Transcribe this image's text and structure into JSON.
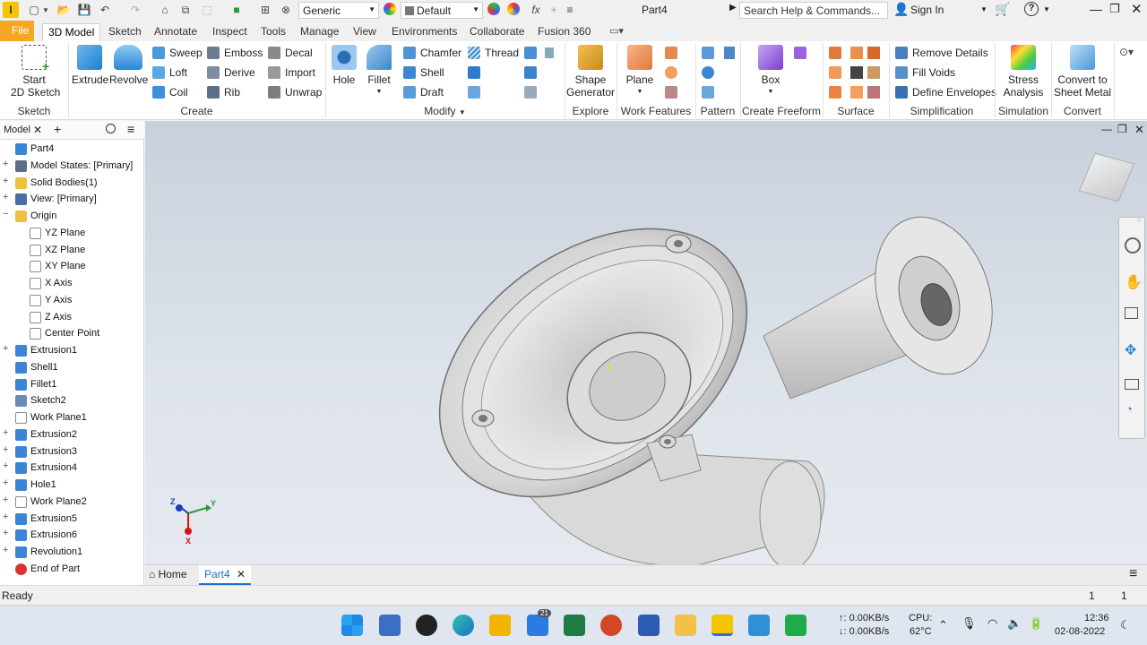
{
  "titlebar": {
    "workspace": "Generic",
    "appearance": "Default",
    "doc_title": "Part4",
    "search_placeholder": "Search Help & Commands...",
    "sign_in": "Sign In",
    "fx": "fx"
  },
  "menu_tabs": [
    "File",
    "3D Model",
    "Sketch",
    "Annotate",
    "Inspect",
    "Tools",
    "Manage",
    "View",
    "Environments",
    "Collaborate",
    "Fusion 360"
  ],
  "ribbon": {
    "sketch": {
      "start_sketch": "Start\n2D Sketch",
      "group": "Sketch"
    },
    "create": {
      "extrude": "Extrude",
      "revolve": "Revolve",
      "sweep": "Sweep",
      "loft": "Loft",
      "coil": "Coil",
      "emboss": "Emboss",
      "derive": "Derive",
      "rib": "Rib",
      "decal": "Decal",
      "import": "Import",
      "unwrap": "Unwrap",
      "group": "Create"
    },
    "modify": {
      "hole": "Hole",
      "fillet": "Fillet",
      "chamfer": "Chamfer",
      "thread": "Thread",
      "shell": "Shell",
      "draft": "Draft",
      "group": "Modify"
    },
    "explore": {
      "shape_generator": "Shape\nGenerator",
      "group": "Explore"
    },
    "work_features": {
      "plane": "Plane",
      "group": "Work Features"
    },
    "pattern": {
      "group": "Pattern"
    },
    "freeform": {
      "box": "Box",
      "group": "Create Freeform"
    },
    "surface": {
      "group": "Surface"
    },
    "simplification": {
      "remove_details": "Remove Details",
      "fill_voids": "Fill Voids",
      "define_envelopes": "Define Envelopes",
      "group": "Simplification"
    },
    "simulation": {
      "stress_analysis": "Stress\nAnalysis",
      "group": "Simulation"
    },
    "convert": {
      "convert_sheet_metal": "Convert to\nSheet Metal",
      "group": "Convert"
    }
  },
  "model_panel": {
    "title": "Model",
    "tree": [
      {
        "label": "Part4",
        "icon": "part-icon",
        "expander": ""
      },
      {
        "label": "Model States: [Primary]",
        "icon": "model-states-icon",
        "expander": "+"
      },
      {
        "label": "Solid Bodies(1)",
        "icon": "folder-icon",
        "expander": "+"
      },
      {
        "label": "View: [Primary]",
        "icon": "view-icon",
        "expander": "+"
      },
      {
        "label": "Origin",
        "icon": "folder-icon",
        "expander": "−"
      },
      {
        "label": "YZ Plane",
        "icon": "plane-icon",
        "expander": ""
      },
      {
        "label": "XZ Plane",
        "icon": "plane-icon",
        "expander": ""
      },
      {
        "label": "XY Plane",
        "icon": "plane-icon",
        "expander": ""
      },
      {
        "label": "X Axis",
        "icon": "axis-icon",
        "expander": ""
      },
      {
        "label": "Y Axis",
        "icon": "axis-icon",
        "expander": ""
      },
      {
        "label": "Z Axis",
        "icon": "axis-icon",
        "expander": ""
      },
      {
        "label": "Center Point",
        "icon": "point-icon",
        "expander": ""
      },
      {
        "label": "Extrusion1",
        "icon": "extrusion-icon",
        "expander": "+"
      },
      {
        "label": "Shell1",
        "icon": "shell-icon",
        "expander": ""
      },
      {
        "label": "Fillet1",
        "icon": "fillet-icon",
        "expander": ""
      },
      {
        "label": "Sketch2",
        "icon": "sketch-icon",
        "expander": ""
      },
      {
        "label": "Work Plane1",
        "icon": "work-plane-icon",
        "expander": ""
      },
      {
        "label": "Extrusion2",
        "icon": "extrusion-icon",
        "expander": "+"
      },
      {
        "label": "Extrusion3",
        "icon": "extrusion-icon",
        "expander": "+"
      },
      {
        "label": "Extrusion4",
        "icon": "extrusion-icon",
        "expander": "+"
      },
      {
        "label": "Hole1",
        "icon": "hole-icon",
        "expander": "+"
      },
      {
        "label": "Work Plane2",
        "icon": "work-plane-icon",
        "expander": "+"
      },
      {
        "label": "Extrusion5",
        "icon": "extrusion-icon",
        "expander": "+"
      },
      {
        "label": "Extrusion6",
        "icon": "extrusion-icon",
        "expander": "+"
      },
      {
        "label": "Revolution1",
        "icon": "revolution-icon",
        "expander": "+"
      },
      {
        "label": "End of Part",
        "icon": "end-of-part-icon",
        "expander": ""
      }
    ]
  },
  "doc_tabs": {
    "home": "Home",
    "part": "Part4"
  },
  "status": {
    "text": "Ready",
    "count1": "1",
    "count2": "1"
  },
  "triad": {
    "x": "X",
    "y": "Y",
    "z": "Z"
  },
  "taskbar": {
    "net_up": "↑: 0.00KB/s",
    "net_down": "↓: 0.00KB/s",
    "cpu_label": "CPU:",
    "cpu_temp": "62°C",
    "time": "12:36",
    "date": "02-08-2022",
    "mail_badge": "21"
  },
  "colors": {
    "accent": "#1a6fc9",
    "file_tab": "#f5a623"
  }
}
